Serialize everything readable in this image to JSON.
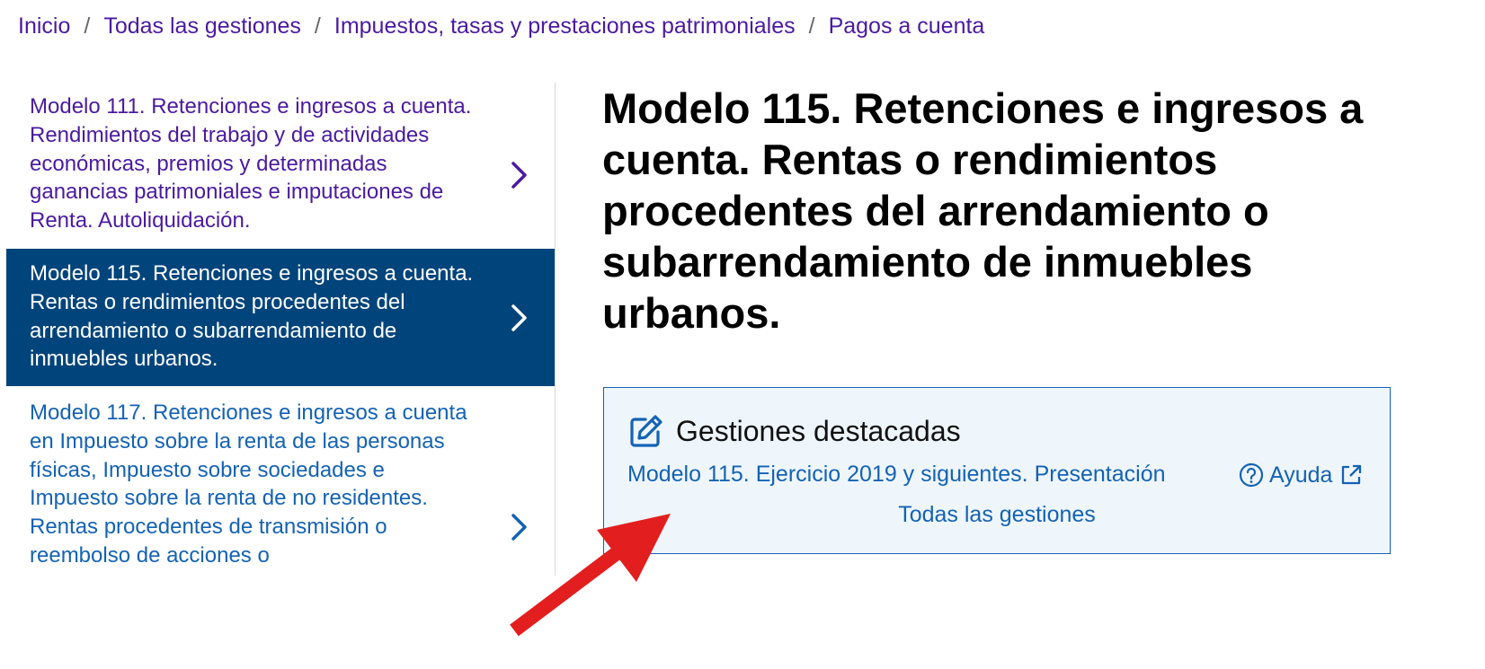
{
  "breadcrumb": {
    "items": [
      "Inicio",
      "Todas las gestiones",
      "Impuestos, tasas y prestaciones patrimoniales",
      "Pagos a cuenta"
    ],
    "separator": "/"
  },
  "sidebar": {
    "items": [
      {
        "label": "Modelo 111. Retenciones e ingresos a cuenta. Rendimientos del trabajo y de actividades económicas, premios y determinadas ganancias patrimoniales e imputaciones de Renta. Autoliquidación.",
        "state": "visited"
      },
      {
        "label": "Modelo 115. Retenciones e ingresos a cuenta. Rentas o rendimientos procedentes del arrendamiento o subarrendamiento de inmuebles urbanos.",
        "state": "active"
      },
      {
        "label": "Modelo 117. Retenciones e ingresos a cuenta en Impuesto sobre la renta de las personas físicas, Impuesto sobre sociedades e Impuesto sobre la renta de no residentes. Rentas procedentes de transmisión o reembolso de acciones o",
        "state": "normal"
      }
    ]
  },
  "main": {
    "title": "Modelo 115. Retenciones e ingresos a cuenta. Rentas o rendimientos procedentes del arrendamiento o subarrendamiento de inmuebles urbanos."
  },
  "featured": {
    "title": "Gestiones destacadas",
    "link": "Modelo 115. Ejercicio 2019 y siguientes. Presentación",
    "help": "Ayuda",
    "all": "Todas las gestiones"
  },
  "colors": {
    "link_visited": "#4a1aa0",
    "link": "#1462b4",
    "active_bg": "#00447c",
    "box_bg": "#eef6fc",
    "arrow": "#e31e1e"
  },
  "icons": {
    "chevron": "chevron-right-icon",
    "edit": "edit-icon",
    "help": "help-circle-icon",
    "external": "external-link-icon",
    "arrow": "annotation-arrow"
  }
}
